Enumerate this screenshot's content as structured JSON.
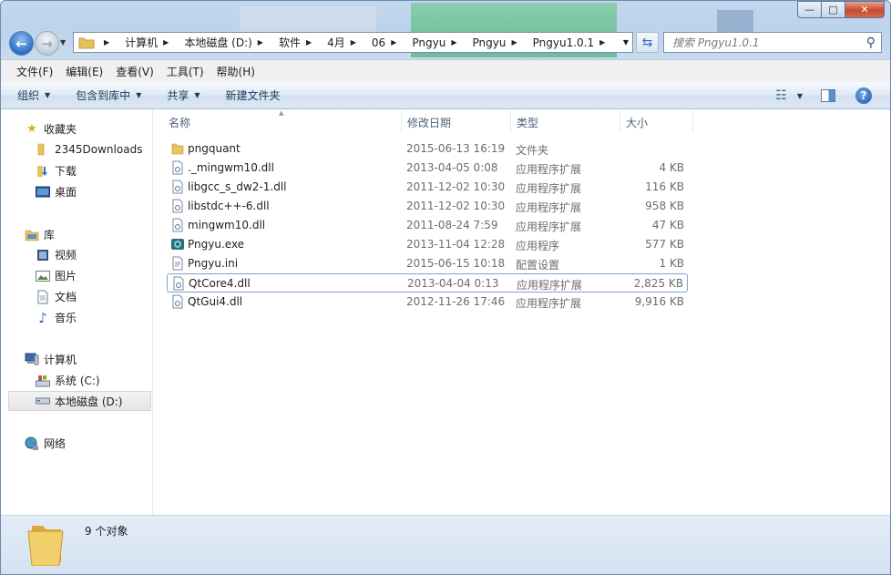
{
  "window": {
    "caption_buttons": {
      "minimize": "—",
      "maximize": "□",
      "close": "✕"
    }
  },
  "nav": {
    "breadcrumbs": [
      "计算机",
      "本地磁盘 (D:)",
      "软件",
      "4月",
      "06",
      "Pngyu",
      "Pngyu",
      "Pngyu1.0.1"
    ],
    "search_placeholder": "搜索 Pngyu1.0.1"
  },
  "menu": [
    "文件(F)",
    "编辑(E)",
    "查看(V)",
    "工具(T)",
    "帮助(H)"
  ],
  "commands": {
    "organize": "组织",
    "include_in_library": "包含到库中",
    "share": "共享",
    "new_folder": "新建文件夹"
  },
  "sidebar": {
    "favorites": {
      "label": "收藏夹",
      "items": [
        "2345Downloads",
        "下载",
        "桌面"
      ]
    },
    "libraries": {
      "label": "库",
      "items": [
        "视频",
        "图片",
        "文档",
        "音乐"
      ]
    },
    "computer": {
      "label": "计算机",
      "items": [
        "系统 (C:)",
        "本地磁盘 (D:)"
      ]
    },
    "network": {
      "label": "网络"
    }
  },
  "columns": {
    "name": "名称",
    "date": "修改日期",
    "type": "类型",
    "size": "大小"
  },
  "files": [
    {
      "name": "pngquant",
      "date": "2015-06-13 16:19",
      "type": "文件夹",
      "size": "",
      "icon": "folder-icon"
    },
    {
      "name": "._mingwm10.dll",
      "date": "2013-04-05 0:08",
      "type": "应用程序扩展",
      "size": "4 KB",
      "icon": "dll-file-icon"
    },
    {
      "name": "libgcc_s_dw2-1.dll",
      "date": "2011-12-02 10:30",
      "type": "应用程序扩展",
      "size": "116 KB",
      "icon": "dll-file-icon"
    },
    {
      "name": "libstdc++-6.dll",
      "date": "2011-12-02 10:30",
      "type": "应用程序扩展",
      "size": "958 KB",
      "icon": "dll-file-icon"
    },
    {
      "name": "mingwm10.dll",
      "date": "2011-08-24 7:59",
      "type": "应用程序扩展",
      "size": "47 KB",
      "icon": "dll-file-icon"
    },
    {
      "name": "Pngyu.exe",
      "date": "2013-11-04 12:28",
      "type": "应用程序",
      "size": "577 KB",
      "icon": "exe-app-icon"
    },
    {
      "name": "Pngyu.ini",
      "date": "2015-06-15 10:18",
      "type": "配置设置",
      "size": "1 KB",
      "icon": "ini-file-icon"
    },
    {
      "name": "QtCore4.dll",
      "date": "2013-04-04 0:13",
      "type": "应用程序扩展",
      "size": "2,825 KB",
      "icon": "dll-file-icon"
    },
    {
      "name": "QtGui4.dll",
      "date": "2012-11-26 17:46",
      "type": "应用程序扩展",
      "size": "9,916 KB",
      "icon": "dll-file-icon"
    }
  ],
  "selected_file": "QtCore4.dll",
  "status": {
    "item_count": "9 个对象"
  }
}
